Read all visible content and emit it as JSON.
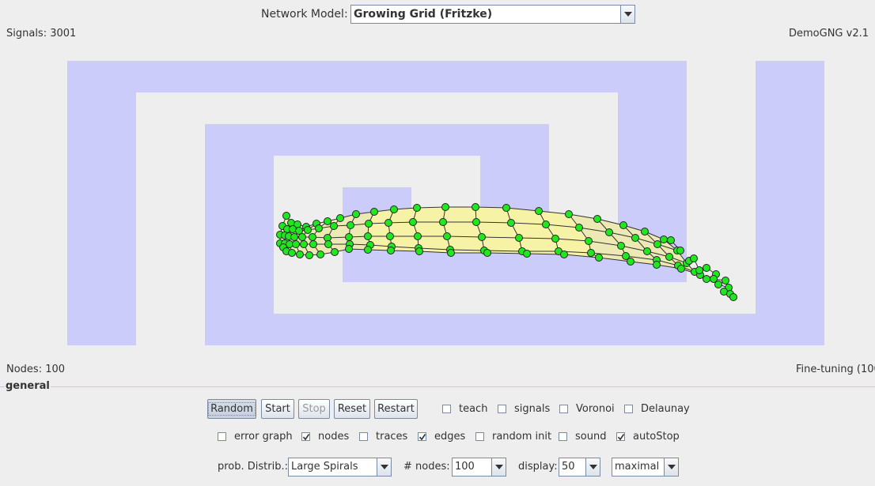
{
  "header": {
    "model_label": "Network Model:",
    "model_value": "Growing Grid  (Fritzke)",
    "signals": "Signals: 3001",
    "version": "DemoGNG v2.1"
  },
  "status": {
    "nodes": "Nodes: 100",
    "phase": "Fine-tuning (100"
  },
  "panel": {
    "title": "general",
    "buttons": {
      "random": "Random",
      "start": "Start",
      "stop": "Stop",
      "reset": "Reset",
      "restart": "Restart"
    },
    "checkboxes": {
      "teach": {
        "label": "teach",
        "checked": false
      },
      "signals": {
        "label": "signals",
        "checked": false
      },
      "voronoi": {
        "label": "Voronoi",
        "checked": false
      },
      "delaunay": {
        "label": "Delaunay",
        "checked": false
      },
      "error_graph": {
        "label": "error graph",
        "checked": false
      },
      "nodes": {
        "label": "nodes",
        "checked": true
      },
      "traces": {
        "label": "traces",
        "checked": false
      },
      "edges": {
        "label": "edges",
        "checked": true
      },
      "random_init": {
        "label": "random init",
        "checked": false
      },
      "sound": {
        "label": "sound",
        "checked": false
      },
      "autostop": {
        "label": "autoStop",
        "checked": true
      }
    },
    "distribution_label": "prob. Distrib.:",
    "distribution_value": "Large Spirals",
    "nodes_label": "# nodes:",
    "nodes_value": "100",
    "display_label": "display:",
    "display_value": "50",
    "speed_value": "maximal"
  },
  "colors": {
    "region": "#ccccfb",
    "background": "#eeeeee",
    "node": "#1fe81f",
    "cell": "#f2efa8"
  },
  "icons": [
    "chevron-down-icon",
    "check-icon"
  ]
}
